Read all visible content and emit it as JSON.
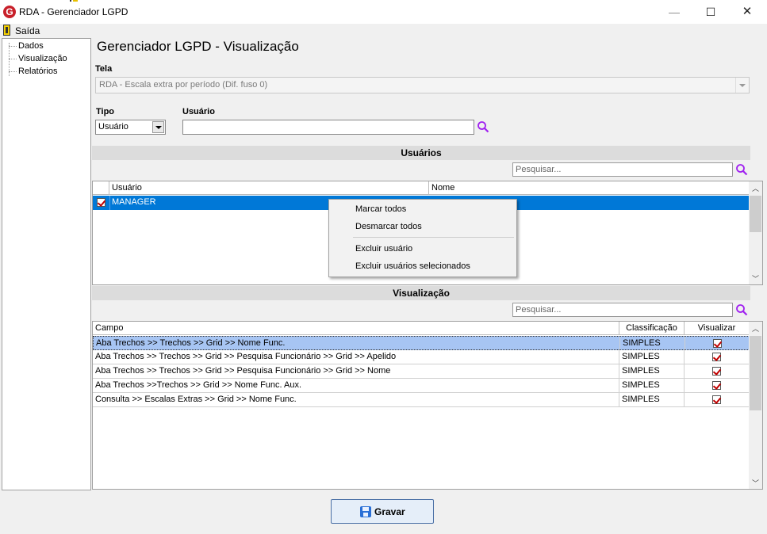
{
  "window": {
    "title": "RDA - Gerenciador LGPD",
    "min": "—",
    "max": "☐",
    "close": "✕"
  },
  "menu": {
    "exit_label": "Saída"
  },
  "tree": {
    "items": [
      {
        "label": "Dados"
      },
      {
        "label": "Visualização"
      },
      {
        "label": "Relatórios"
      }
    ]
  },
  "page": {
    "title": "Gerenciador LGPD - Visualização"
  },
  "tela": {
    "label": "Tela",
    "value": "RDA - Escala extra por período (Dif. fuso 0)"
  },
  "tipo": {
    "label": "Tipo",
    "value": "Usuário"
  },
  "usuario": {
    "label": "Usuário",
    "value": ""
  },
  "users_section": {
    "title": "Usuários",
    "search_placeholder": "Pesquisar...",
    "columns": [
      "Usuário",
      "Nome"
    ],
    "rows": [
      {
        "checked": true,
        "usuario": "MANAGER",
        "nome": ""
      }
    ]
  },
  "context_menu": {
    "items": [
      "Marcar todos",
      "Desmarcar todos",
      "Excluir usuário",
      "Excluir usuários selecionados"
    ]
  },
  "vis_section": {
    "title": "Visualização",
    "search_placeholder": "Pesquisar...",
    "columns": [
      "Campo",
      "Classificação",
      "Visualizar"
    ],
    "rows": [
      {
        "campo": "Aba Trechos >> Trechos >> Grid >> Nome Func.",
        "classificacao": "SIMPLES",
        "visualizar": true
      },
      {
        "campo": "Aba Trechos >> Trechos >> Grid >> Pesquisa Funcionário >> Grid >> Apelido",
        "classificacao": "SIMPLES",
        "visualizar": true
      },
      {
        "campo": "Aba Trechos >> Trechos >> Grid >> Pesquisa Funcionário >> Grid >> Nome",
        "classificacao": "SIMPLES",
        "visualizar": true
      },
      {
        "campo": "Aba Trechos >>Trechos >> Grid >> Nome Func. Aux.",
        "classificacao": "SIMPLES",
        "visualizar": true
      },
      {
        "campo": "Consulta >> Escalas Extras >> Grid >> Nome Func.",
        "classificacao": "SIMPLES",
        "visualizar": true
      }
    ]
  },
  "save_button": {
    "label": "Gravar"
  },
  "colors": {
    "selection": "#0078d7",
    "row_selection": "#a7c5f3",
    "accent": "#a020f0"
  },
  "icons": [
    "app-logo-icon",
    "exit-door-icon",
    "search-icon",
    "save-disk-icon",
    "chevron-up-icon",
    "chevron-down-icon"
  ]
}
